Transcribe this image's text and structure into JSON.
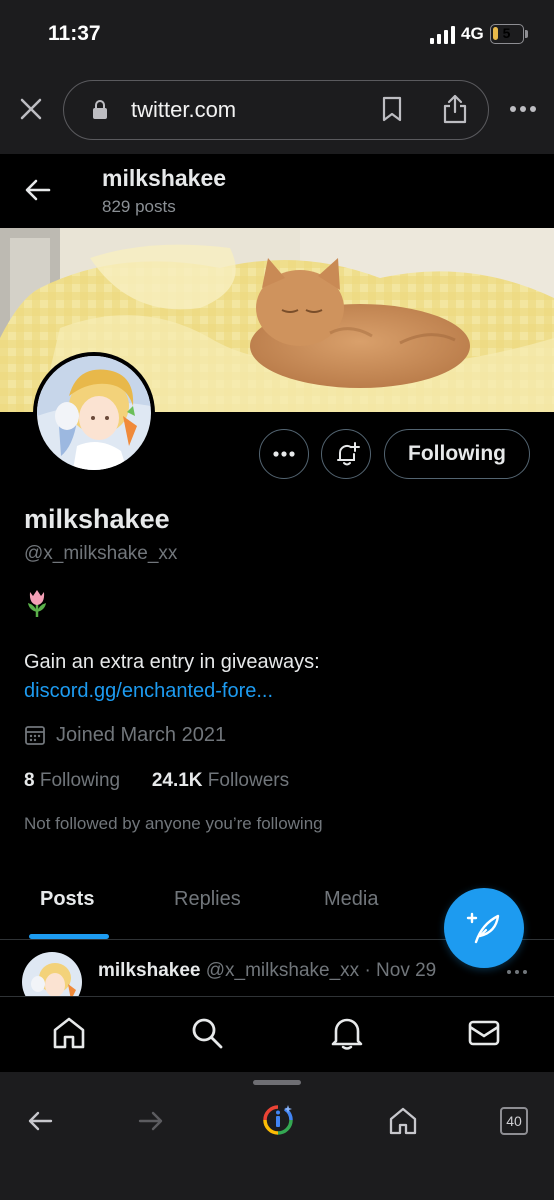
{
  "status_bar": {
    "time": "11:37",
    "network": "4G",
    "battery": "5",
    "battery_level": 0.2,
    "battery_color": "#e8b94a"
  },
  "browser": {
    "url": "twitter.com",
    "tab_count": "40"
  },
  "header": {
    "name": "milkshakee",
    "posts": "829 posts"
  },
  "profile": {
    "name": "milkshakee",
    "handle": "@x_milkshake_xx",
    "emoji": "tulip",
    "bio": "Gain an extra entry in giveaways:",
    "link": "discord.gg/enchanted-fore...",
    "joined": "Joined March 2021",
    "following_count": "8",
    "following_label": "Following",
    "followers_count": "24.1K",
    "followers_label": "Followers",
    "not_followed": "Not followed by anyone you’re following",
    "follow_button": "Following"
  },
  "tabs": [
    {
      "label": "Posts",
      "active": true
    },
    {
      "label": "Replies",
      "active": false
    },
    {
      "label": "Media",
      "active": false
    }
  ],
  "tweet": {
    "name": "milkshakee",
    "handle": "@x_milkshake_xx",
    "date": "· Nov 29"
  },
  "colors": {
    "accent": "#1d9bf0",
    "bg": "#000000",
    "muted": "#71767b"
  }
}
